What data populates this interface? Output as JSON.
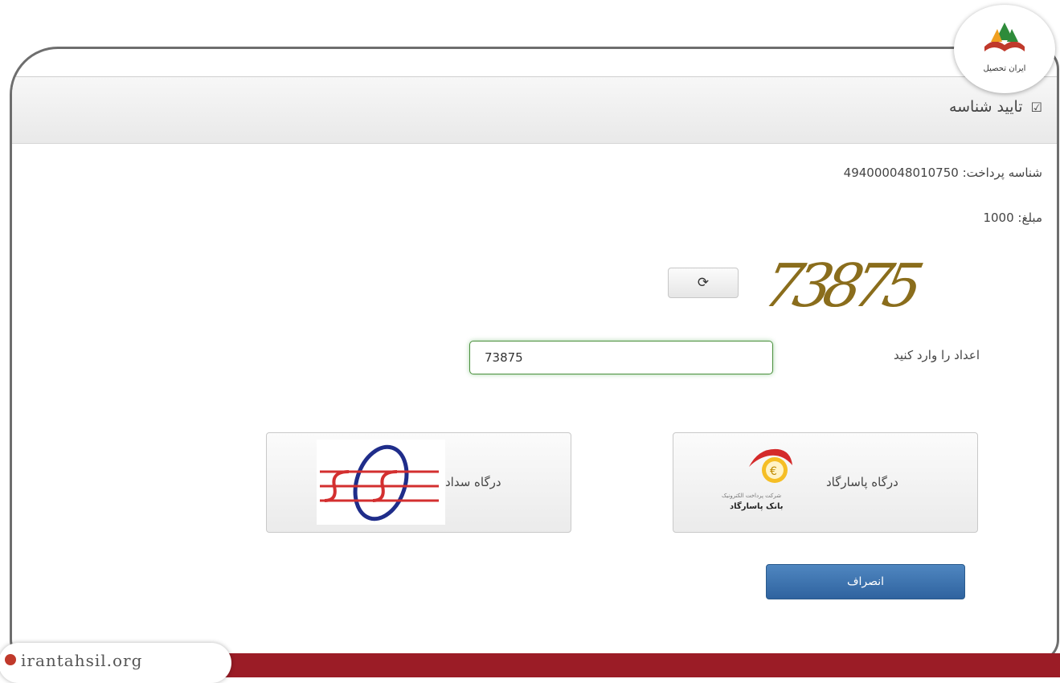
{
  "header": {
    "title": "تایید شناسه",
    "check_icon": "checkbox-checked-icon"
  },
  "payment": {
    "id_label": "شناسه پرداخت:",
    "id_value": "494000048010750",
    "amount_label": "مبلغ:",
    "amount_value": "1000"
  },
  "captcha": {
    "image_text": "73875",
    "refresh_icon": "refresh-icon",
    "prompt": "اعداد را وارد کنید",
    "input_value": "73875"
  },
  "gateways": [
    {
      "label": "درگاه پاسارگاد",
      "logo_small": "شرکت پرداخت الکترونیک",
      "logo_name": "بانک پاسارگاد"
    },
    {
      "label": "درگاه سداد"
    }
  ],
  "cancel_label": "انصراف",
  "brand": {
    "logo_text": "ایران تحصیل",
    "watermark": "irantahsil.org"
  },
  "colors": {
    "accent": "#2f639f",
    "bar": "#9b1c26",
    "captcha": "#8a6d1c"
  }
}
